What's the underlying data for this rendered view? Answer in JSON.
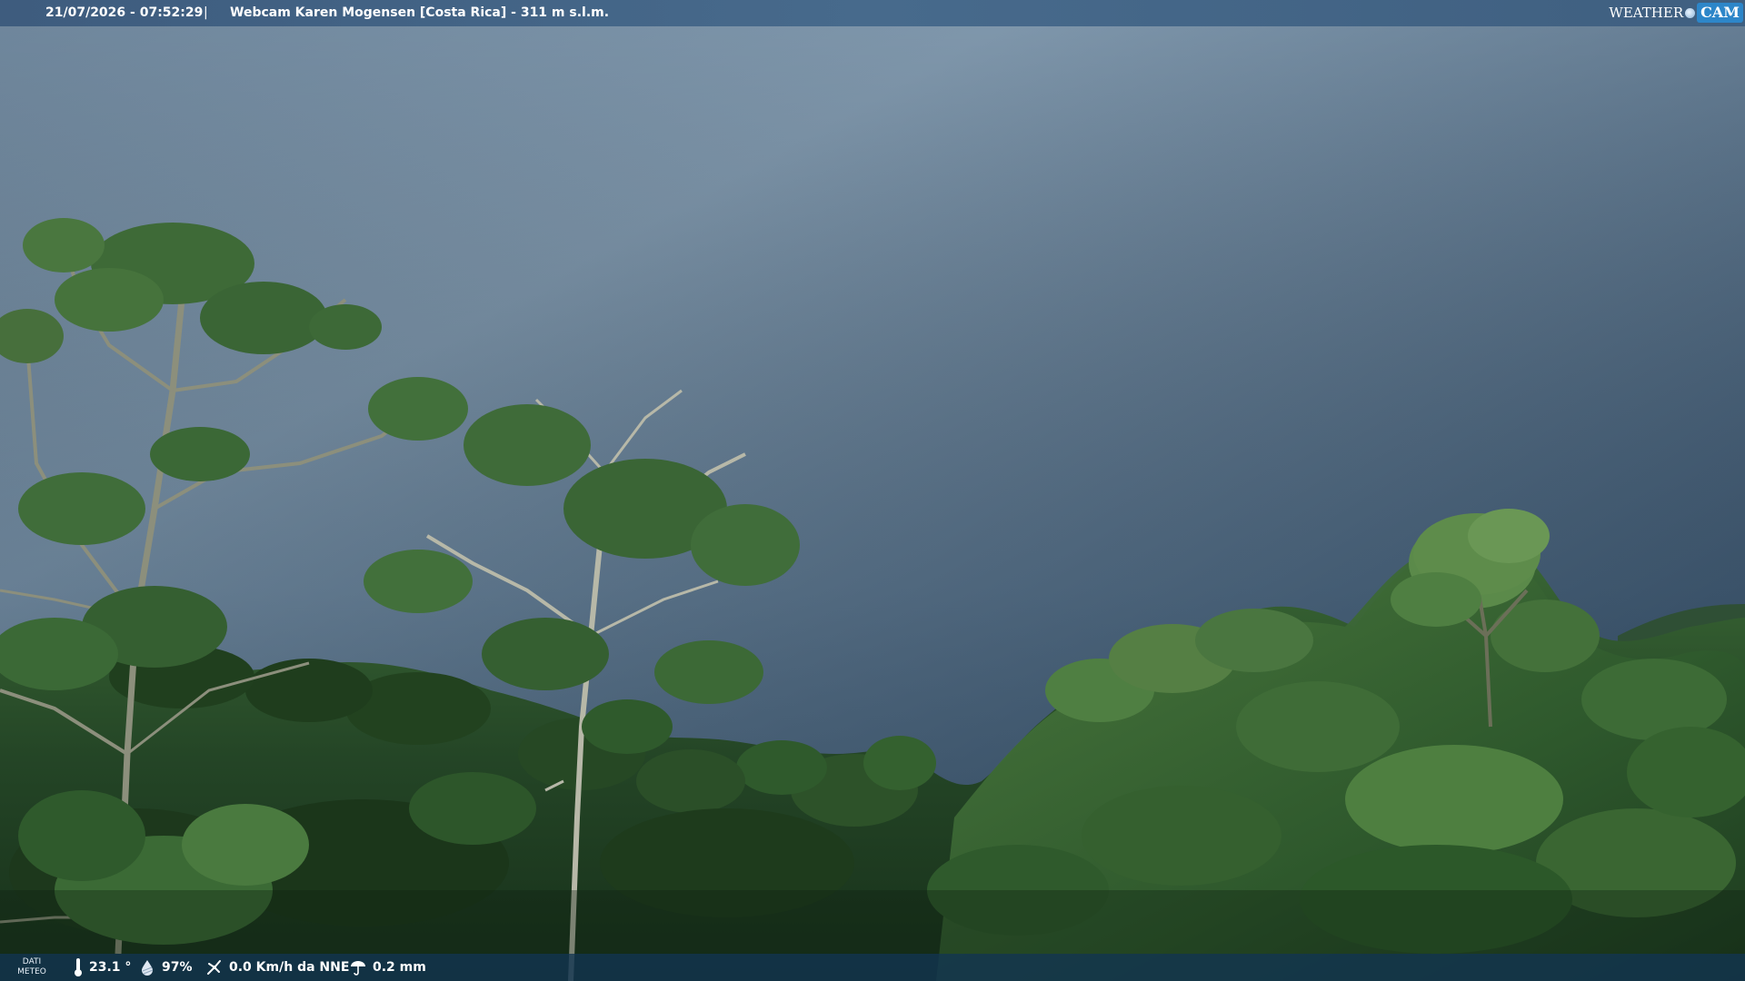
{
  "header": {
    "timestamp": "21/07/2026 - 07:52:29",
    "separator": "|",
    "title": "Webcam Karen Mogensen [Costa Rica]  - 311 m s.l.m."
  },
  "logo": {
    "text_weather": "WEATHER",
    "text_cam": "CAM"
  },
  "weather_bar": {
    "label_line1": "DATI",
    "label_line2": "METEO",
    "temperature": "23.1 °",
    "humidity": "97%",
    "wind": "0.0 Km/h da NNE",
    "rain": "0.2 mm"
  },
  "icons": [
    "thermometer-icon",
    "humidity-icon",
    "wind-icon",
    "rain-icon",
    "weathercam-logo-icon"
  ],
  "colors": {
    "sky_top": "#7f98ae",
    "sky_bottom": "#3c546c",
    "foliage_dark": "#1f3a22",
    "foliage_mid": "#3d6b36",
    "foliage_light": "#6f9a55",
    "bar_blue": "#476a8c",
    "logo_blue": "#2d86c9"
  }
}
